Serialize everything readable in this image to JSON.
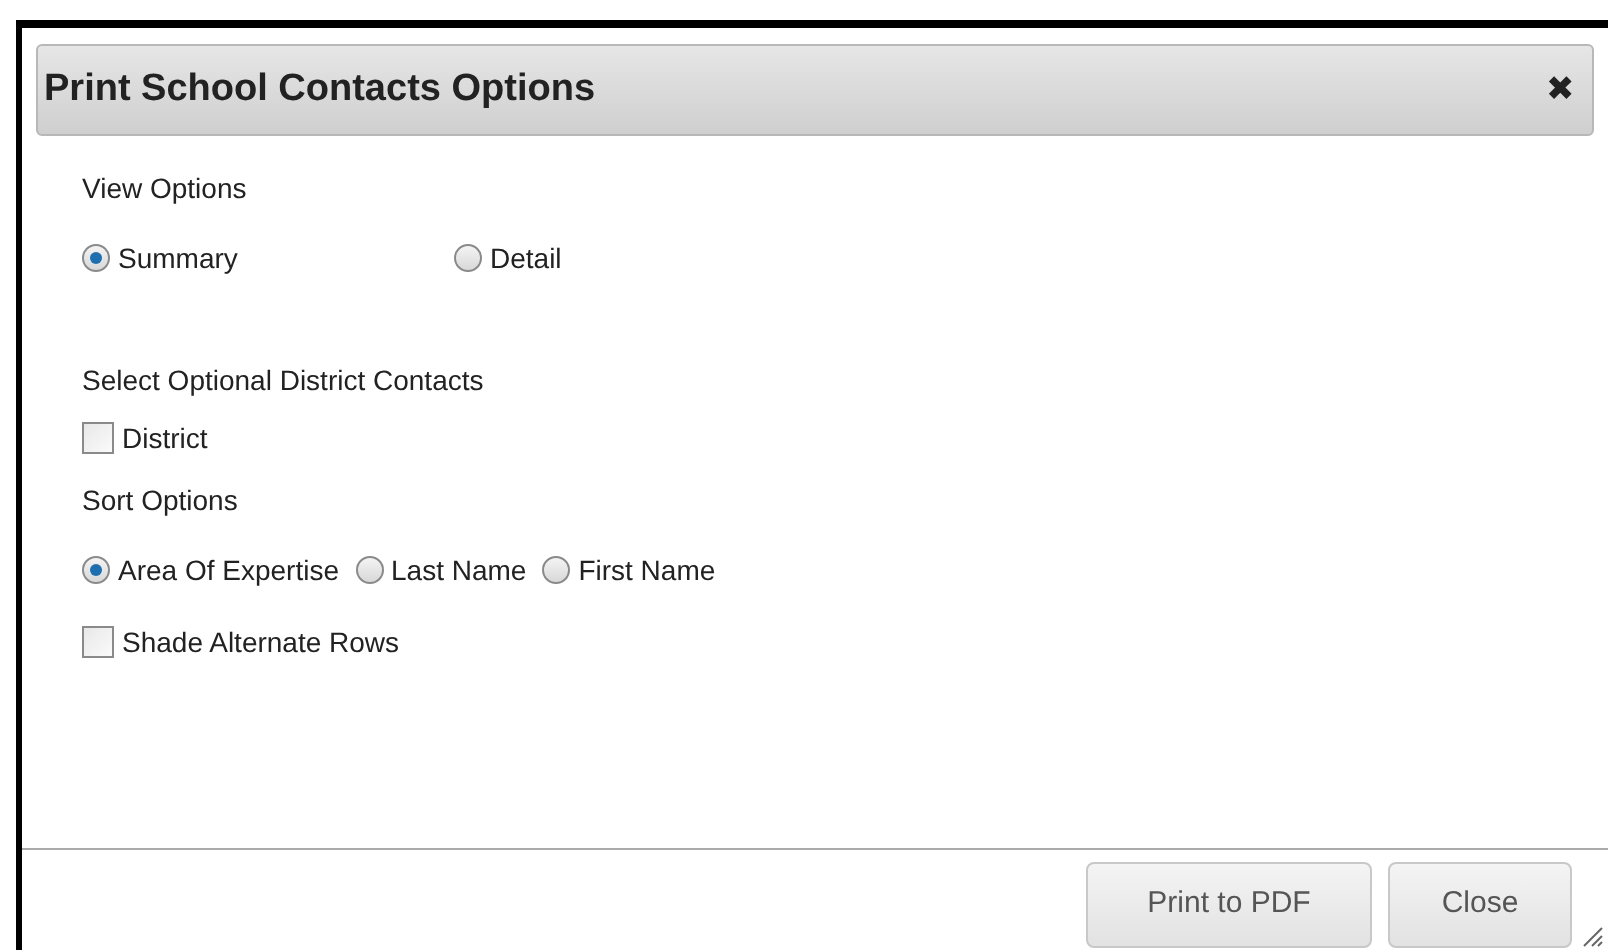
{
  "dialog": {
    "title": "Print School Contacts Options",
    "close_icon": "✖"
  },
  "sections": [
    {
      "kind": "radios",
      "label": "View Options",
      "options": [
        {
          "label": "Summary",
          "selected": true
        },
        {
          "label": "Detail",
          "selected": false
        }
      ]
    },
    {
      "kind": "checkboxes",
      "label": "Select Optional District Contacts",
      "options": [
        {
          "label": "District",
          "checked": false
        }
      ]
    },
    {
      "kind": "radios",
      "label": "Sort Options",
      "options": [
        {
          "label": "Area Of Expertise",
          "selected": true
        },
        {
          "label": "Last Name",
          "selected": false
        },
        {
          "label": "First Name",
          "selected": false
        }
      ]
    },
    {
      "kind": "checkboxes",
      "options": [
        {
          "label": "Shade Alternate Rows",
          "checked": false
        }
      ]
    }
  ],
  "buttons": [
    "Print to PDF",
    "Close"
  ]
}
